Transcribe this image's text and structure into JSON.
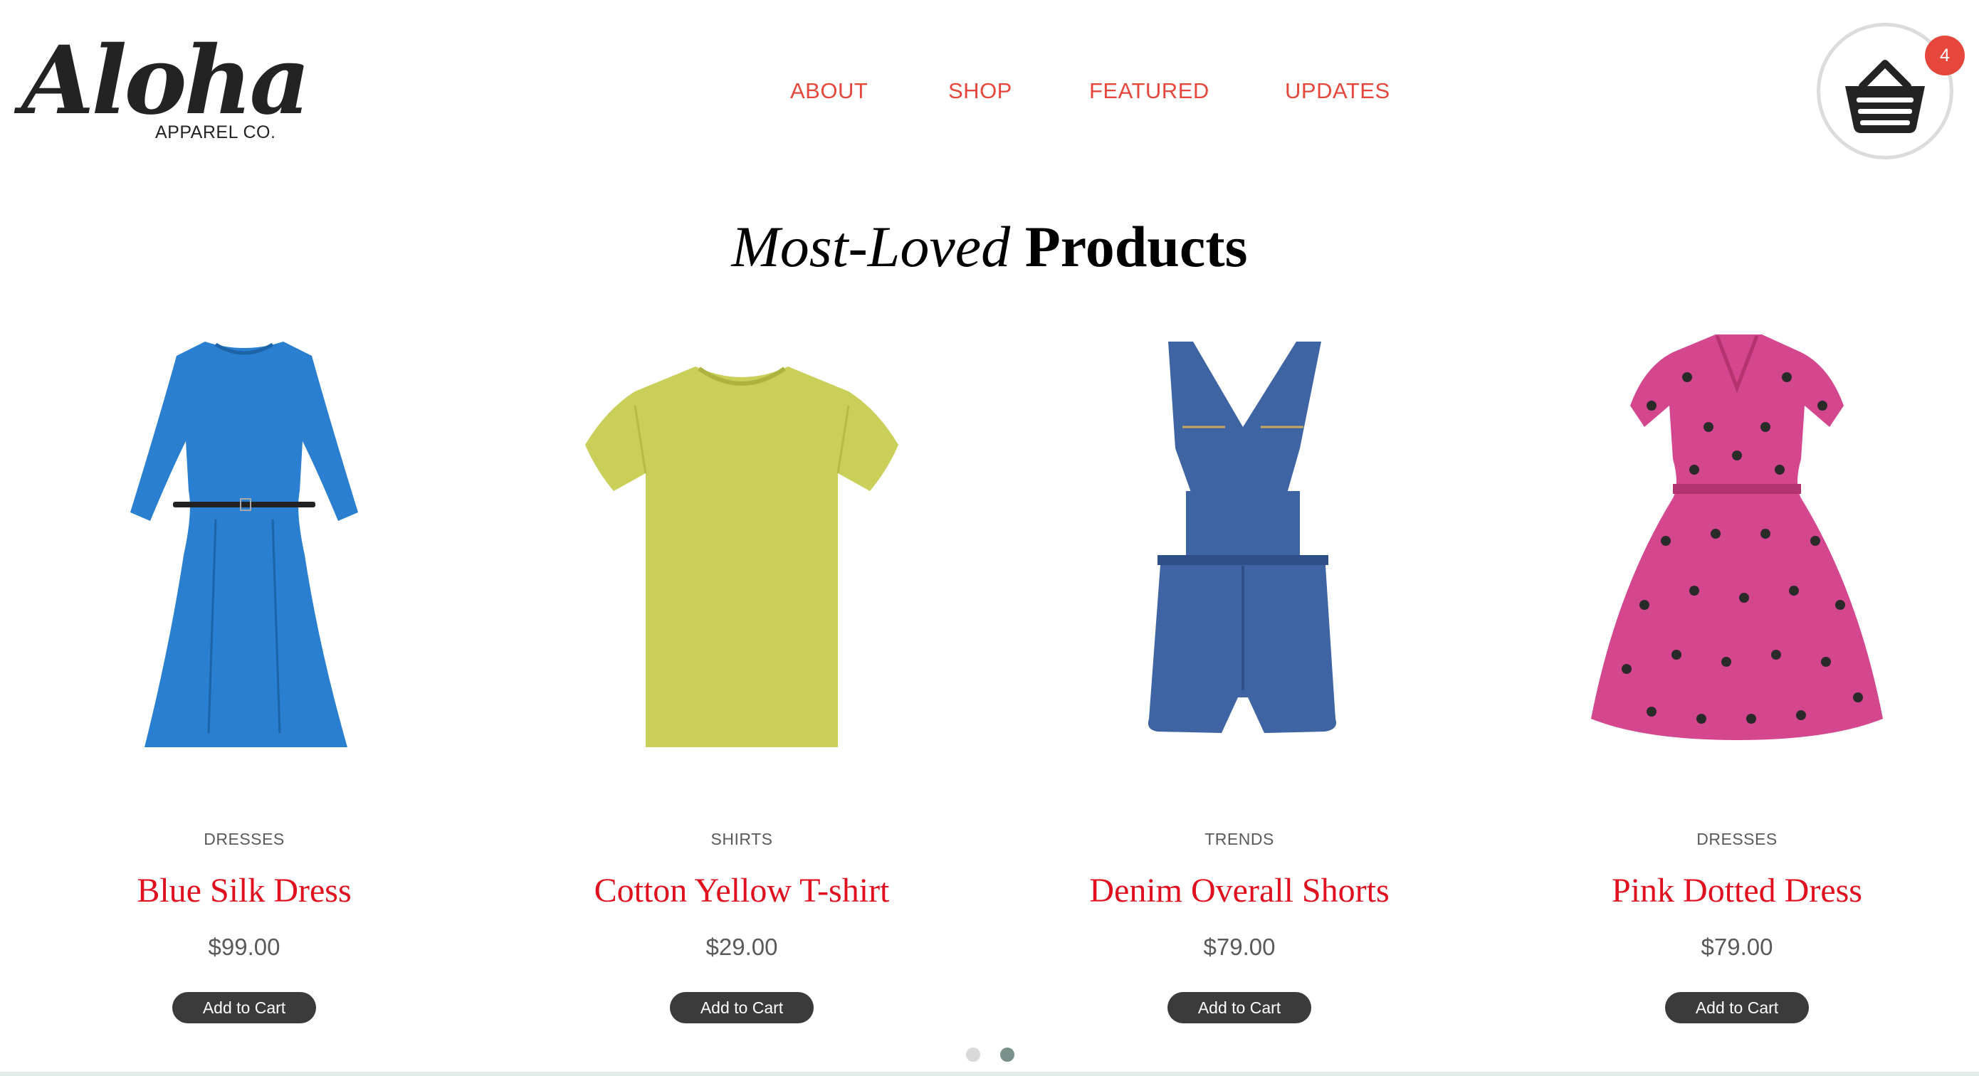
{
  "brand": {
    "name": "Aloha",
    "subtitle": "APPAREL CO."
  },
  "nav": {
    "items": [
      "ABOUT",
      "SHOP",
      "FEATURED",
      "UPDATES"
    ]
  },
  "cart": {
    "count": "4",
    "icon": "basket-icon"
  },
  "heading": {
    "italic": "Most-Loved",
    "bold": "Products"
  },
  "products": [
    {
      "category": "DRESSES",
      "name": "Blue Silk Dress",
      "price": "$99.00",
      "button": "Add to Cart",
      "color": "#2a7fd0"
    },
    {
      "category": "SHIRTS",
      "name": "Cotton Yellow T-shirt",
      "price": "$29.00",
      "button": "Add to Cart",
      "color": "#c9cf58"
    },
    {
      "category": "TRENDS",
      "name": "Denim Overall Shorts",
      "price": "$79.00",
      "button": "Add to Cart",
      "color": "#3e64a3"
    },
    {
      "category": "DRESSES",
      "name": "Pink Dotted Dress",
      "price": "$79.00",
      "button": "Add to Cart",
      "color": "#d4468d"
    }
  ],
  "carousel": {
    "pages": 2,
    "active": 2
  },
  "colors": {
    "accent": "#e6473d",
    "title_red": "#e0101f",
    "button_bg": "#3b3b3b",
    "dot_inactive": "#d9d9d9",
    "dot_active": "#7a908a"
  }
}
